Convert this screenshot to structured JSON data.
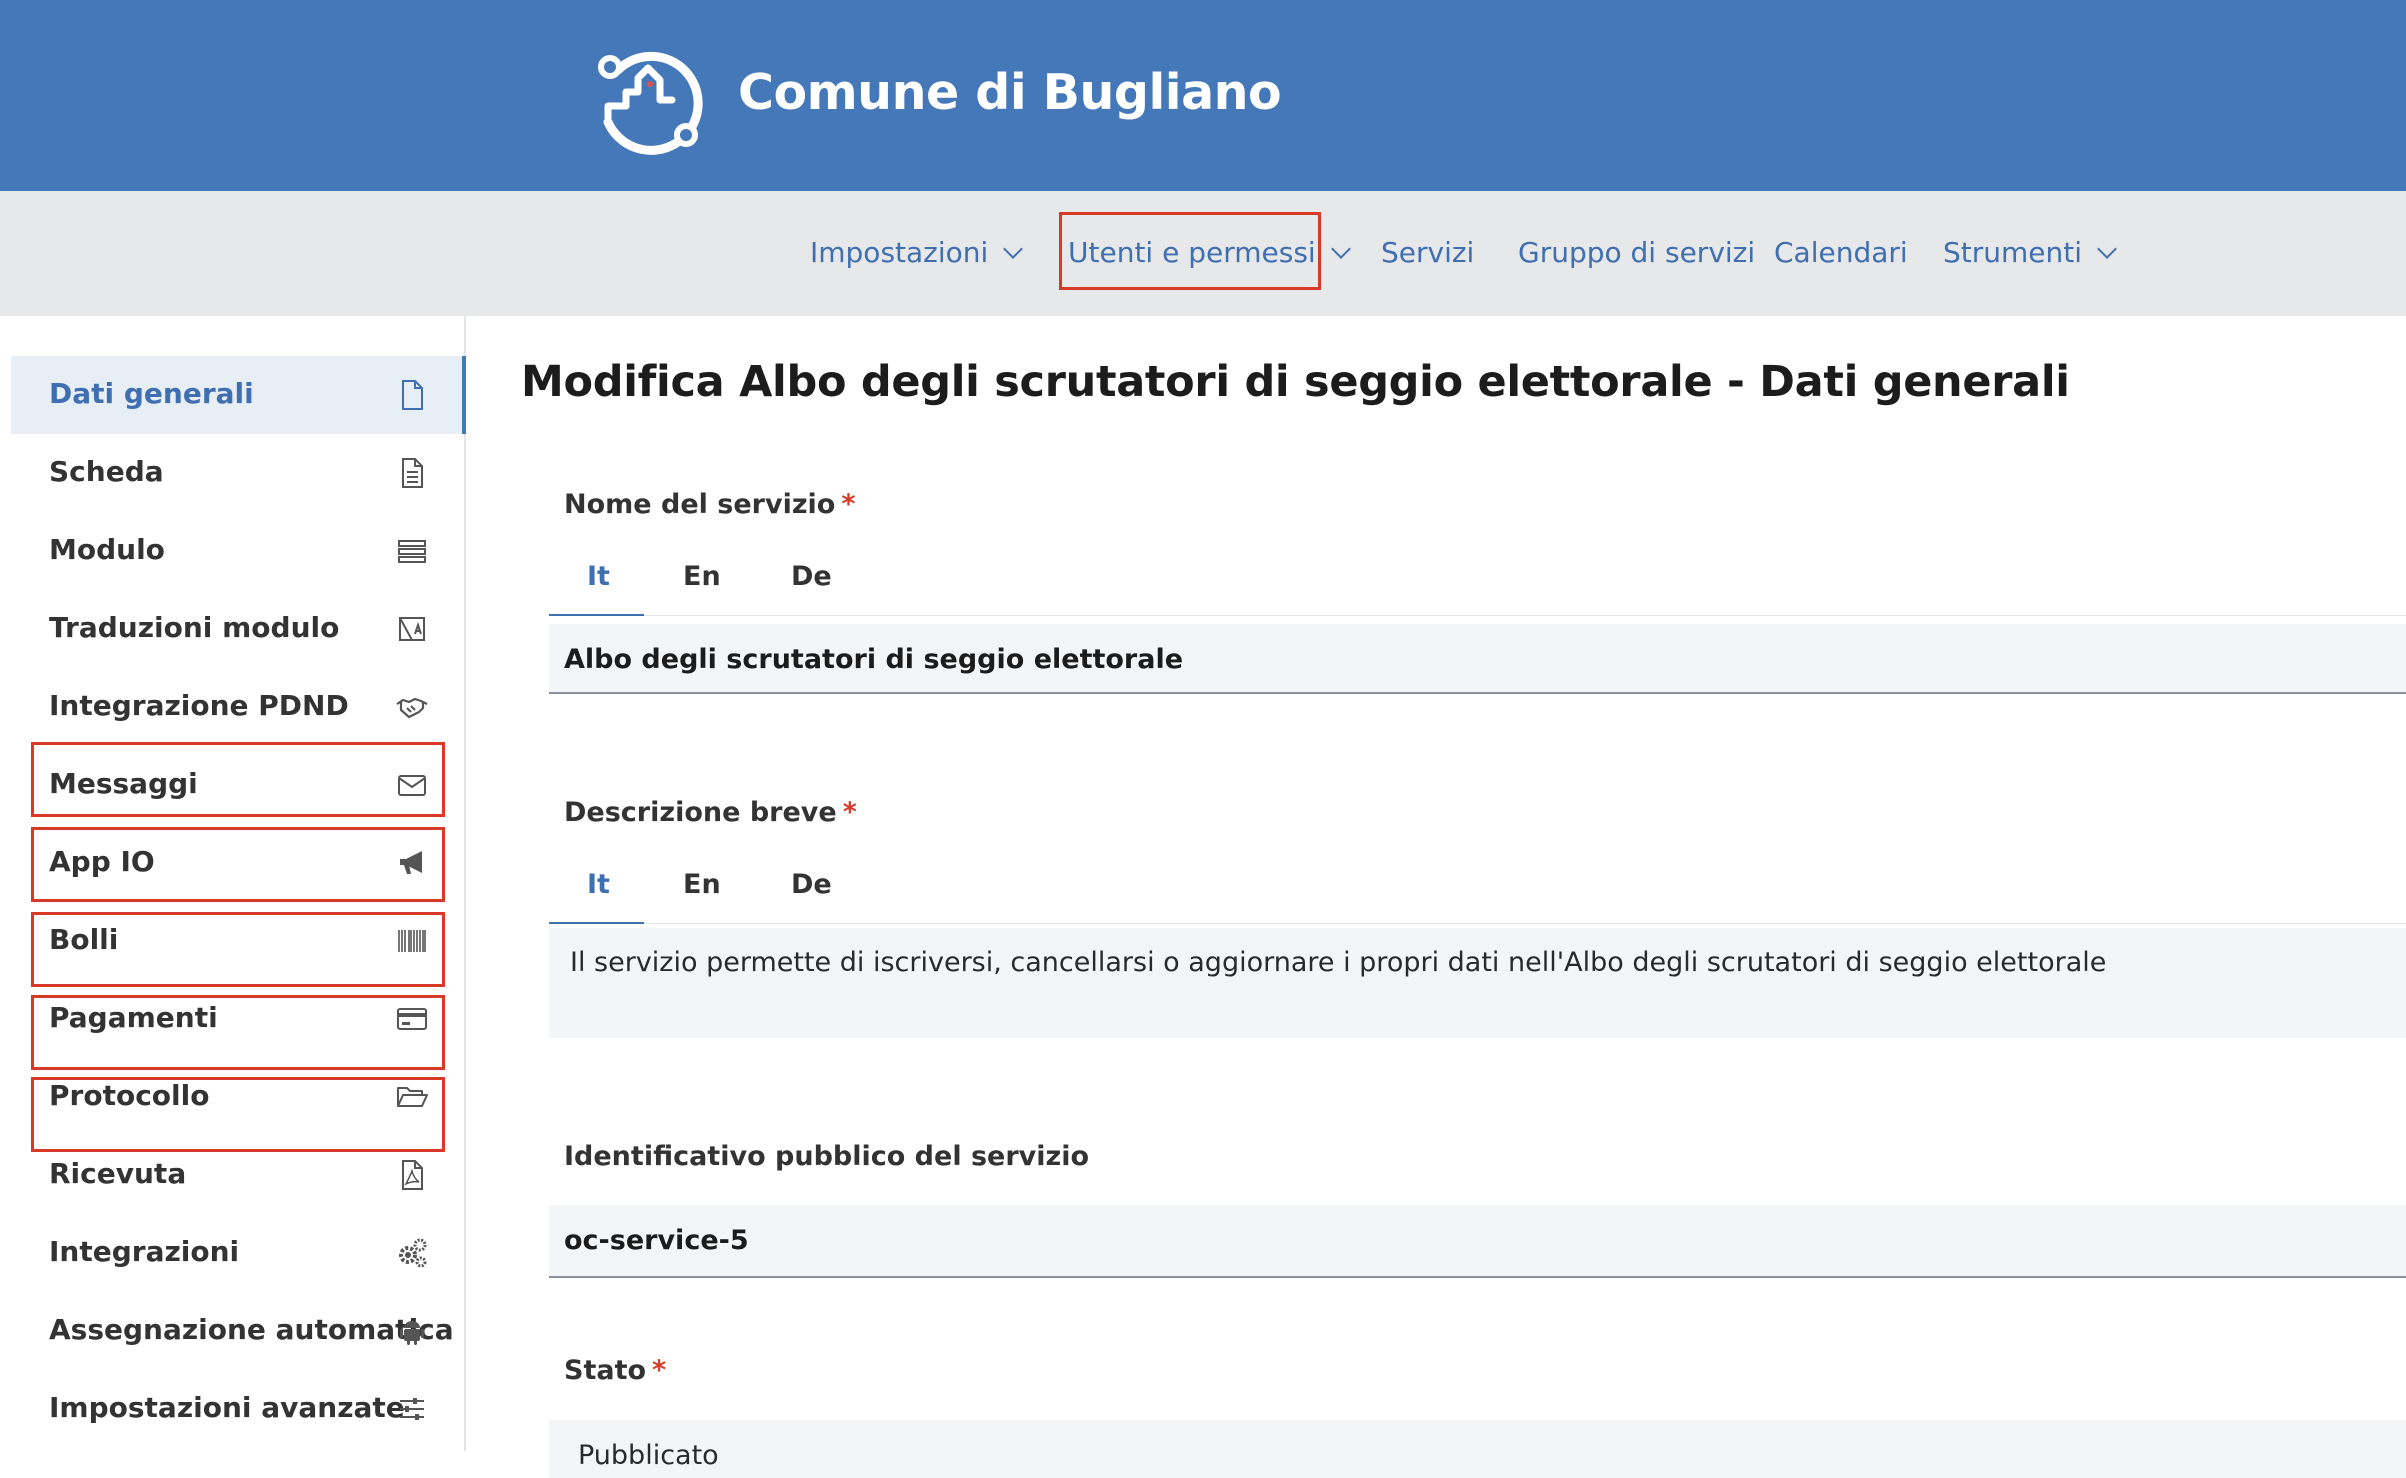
{
  "header": {
    "title": "Comune di Bugliano",
    "logo_icon": "municipality-logo-icon",
    "bg_color": "#4478b8"
  },
  "nav": {
    "items": [
      {
        "label": "Impostazioni",
        "has_dropdown": true
      },
      {
        "label": "Utenti e permessi",
        "has_dropdown": true,
        "highlighted": true
      },
      {
        "label": "Servizi",
        "has_dropdown": false
      },
      {
        "label": "Gruppo di servizi",
        "has_dropdown": false
      },
      {
        "label": "Calendari",
        "has_dropdown": false
      },
      {
        "label": "Strumenti",
        "has_dropdown": true
      }
    ]
  },
  "sidebar": {
    "items": [
      {
        "label": "Dati generali",
        "icon": "file-icon",
        "active": true
      },
      {
        "label": "Scheda",
        "icon": "file-text-icon"
      },
      {
        "label": "Modulo",
        "icon": "form-list-icon"
      },
      {
        "label": "Traduzioni modulo",
        "icon": "translate-icon"
      },
      {
        "label": "Integrazione PDND",
        "icon": "handshake-icon"
      },
      {
        "label": "Messaggi",
        "icon": "envelope-icon",
        "highlighted": true
      },
      {
        "label": "App IO",
        "icon": "megaphone-icon",
        "highlighted": true
      },
      {
        "label": "Bolli",
        "icon": "barcode-icon",
        "highlighted": true
      },
      {
        "label": "Pagamenti",
        "icon": "credit-card-icon",
        "highlighted": true
      },
      {
        "label": "Protocollo",
        "icon": "folder-open-icon",
        "highlighted": true
      },
      {
        "label": "Ricevuta",
        "icon": "pdf-file-icon"
      },
      {
        "label": "Integrazioni",
        "icon": "gears-icon"
      },
      {
        "label": "Assegnazione automatica",
        "icon": "android-icon"
      },
      {
        "label": "Impostazioni avanzate",
        "icon": "sliders-icon"
      }
    ]
  },
  "main": {
    "title": "Modifica Albo degli scrutatori di seggio elettorale - Dati generali",
    "service_name": {
      "label": "Nome del servizio",
      "required_mark": "*",
      "tabs": [
        "It",
        "En",
        "De"
      ],
      "active_tab": "It",
      "value": "Albo degli scrutatori di seggio elettorale"
    },
    "short_description": {
      "label": "Descrizione breve",
      "required_mark": "*",
      "tabs": [
        "It",
        "En",
        "De"
      ],
      "active_tab": "It",
      "value": "Il servizio permette di iscriversi, cancellarsi o aggiornare i propri dati nell'Albo degli scrutatori di seggio elettorale"
    },
    "public_identifier": {
      "label": "Identificativo pubblico del servizio",
      "value": "oc-service-5"
    },
    "status": {
      "label": "Stato",
      "required_mark": "*",
      "value": "Pubblicato"
    }
  },
  "colors": {
    "accent": "#3f6fb0",
    "highlight_box": "#d93a27",
    "nav_bg": "#e7e8ea"
  }
}
